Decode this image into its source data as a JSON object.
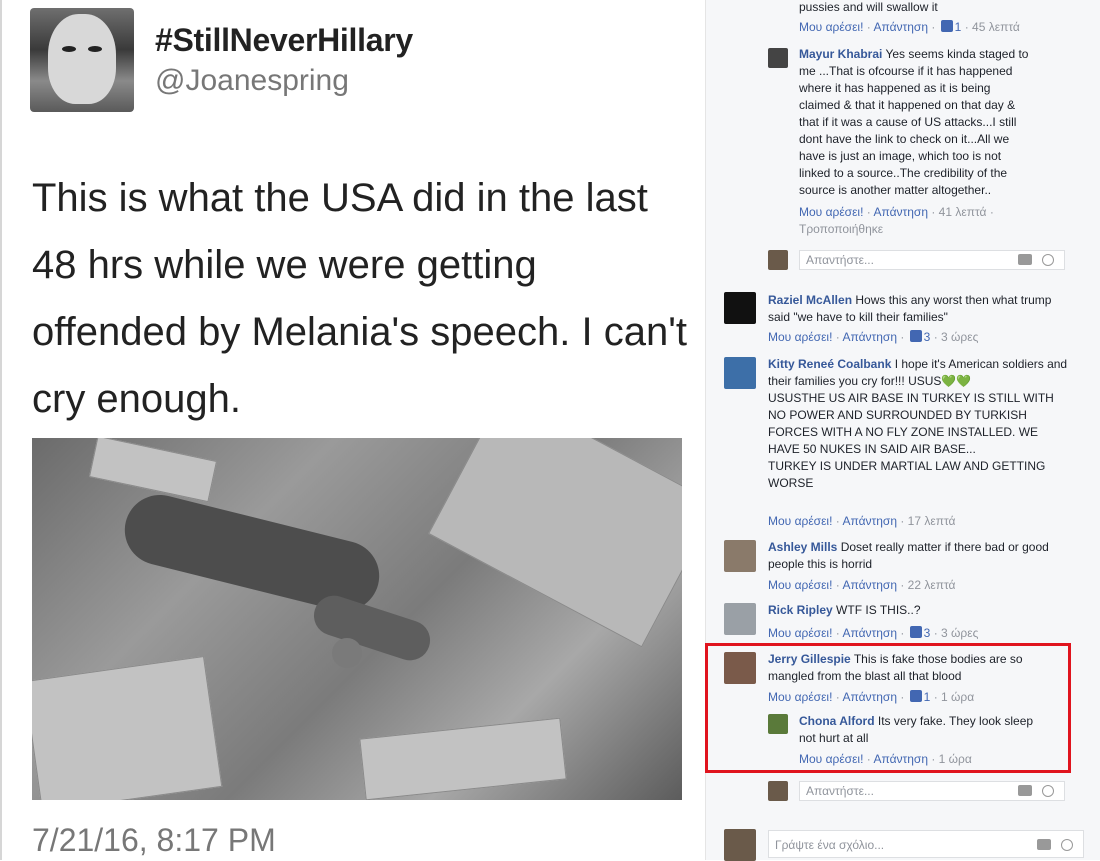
{
  "tweet": {
    "display_name": "#StillNeverHillary",
    "handle": "@Joanespring",
    "text": "This is what the USA did in the last 48 hrs while we were getting offended by Melania's speech. I can't cry enough.",
    "timestamp": "7/21/16, 8:17 PM"
  },
  "labels": {
    "like": "Μου αρέσει!",
    "reply": "Απάντηση",
    "edited": "Τροποποιήθηκε"
  },
  "comments": [
    {
      "name": "",
      "text": "pussies and will swallow it",
      "likes": "1",
      "time": "45 λεπτά"
    },
    {
      "name": "Mayur Khabrai",
      "text": "Yes seems kinda staged to me ...That is ofcourse if it has happened where it has happened as it is being claimed & that it happened on that day & that if it was a cause of US attacks...I still dont have the link to check on it...All we have is just an image, which too is not linked to a source..The credibility of the source is another matter altogether..",
      "time": "41 λεπτά"
    },
    {
      "name": "Raziel McAllen",
      "text": "Hows this any worst then what trump said \"we have to kill their families\"",
      "likes": "3",
      "time": "3 ώρες"
    },
    {
      "name": "Kitty Reneé Coalbank",
      "text": "I hope it's American soldiers and their families you cry for!!!",
      "emoji_text": "USUS💚💚",
      "text2": "USUSTHE US AIR BASE IN TURKEY IS STILL WITH NO POWER AND SURROUNDED BY TURKISH FORCES WITH A NO FLY ZONE INSTALLED. WE HAVE 50 NUKES IN SAID AIR BASE...",
      "text3": "TURKEY IS UNDER MARTIAL LAW AND GETTING WORSE",
      "time": "17 λεπτά"
    },
    {
      "name": "Ashley Mills",
      "text": "Doset really matter if there bad or good people this is horrid",
      "time": "22 λεπτά"
    },
    {
      "name": "Rick Ripley",
      "text": "WTF IS THIS..?",
      "likes": "3",
      "time": "3 ώρες"
    },
    {
      "name": "Jerry Gillespie",
      "text": "This is fake those bodies are so mangled from the blast all that blood",
      "likes": "1",
      "time": "1 ώρα"
    },
    {
      "name": "Chona Alford",
      "text": "Its very fake. They look sleep not hurt at all",
      "time": "1 ώρα"
    }
  ],
  "reply_placeholder": "Απαντήστε...",
  "comment_placeholder": "Γράψτε ένα σχόλιο...",
  "colors": {
    "link": "#365899",
    "highlight": "#e0141e"
  }
}
